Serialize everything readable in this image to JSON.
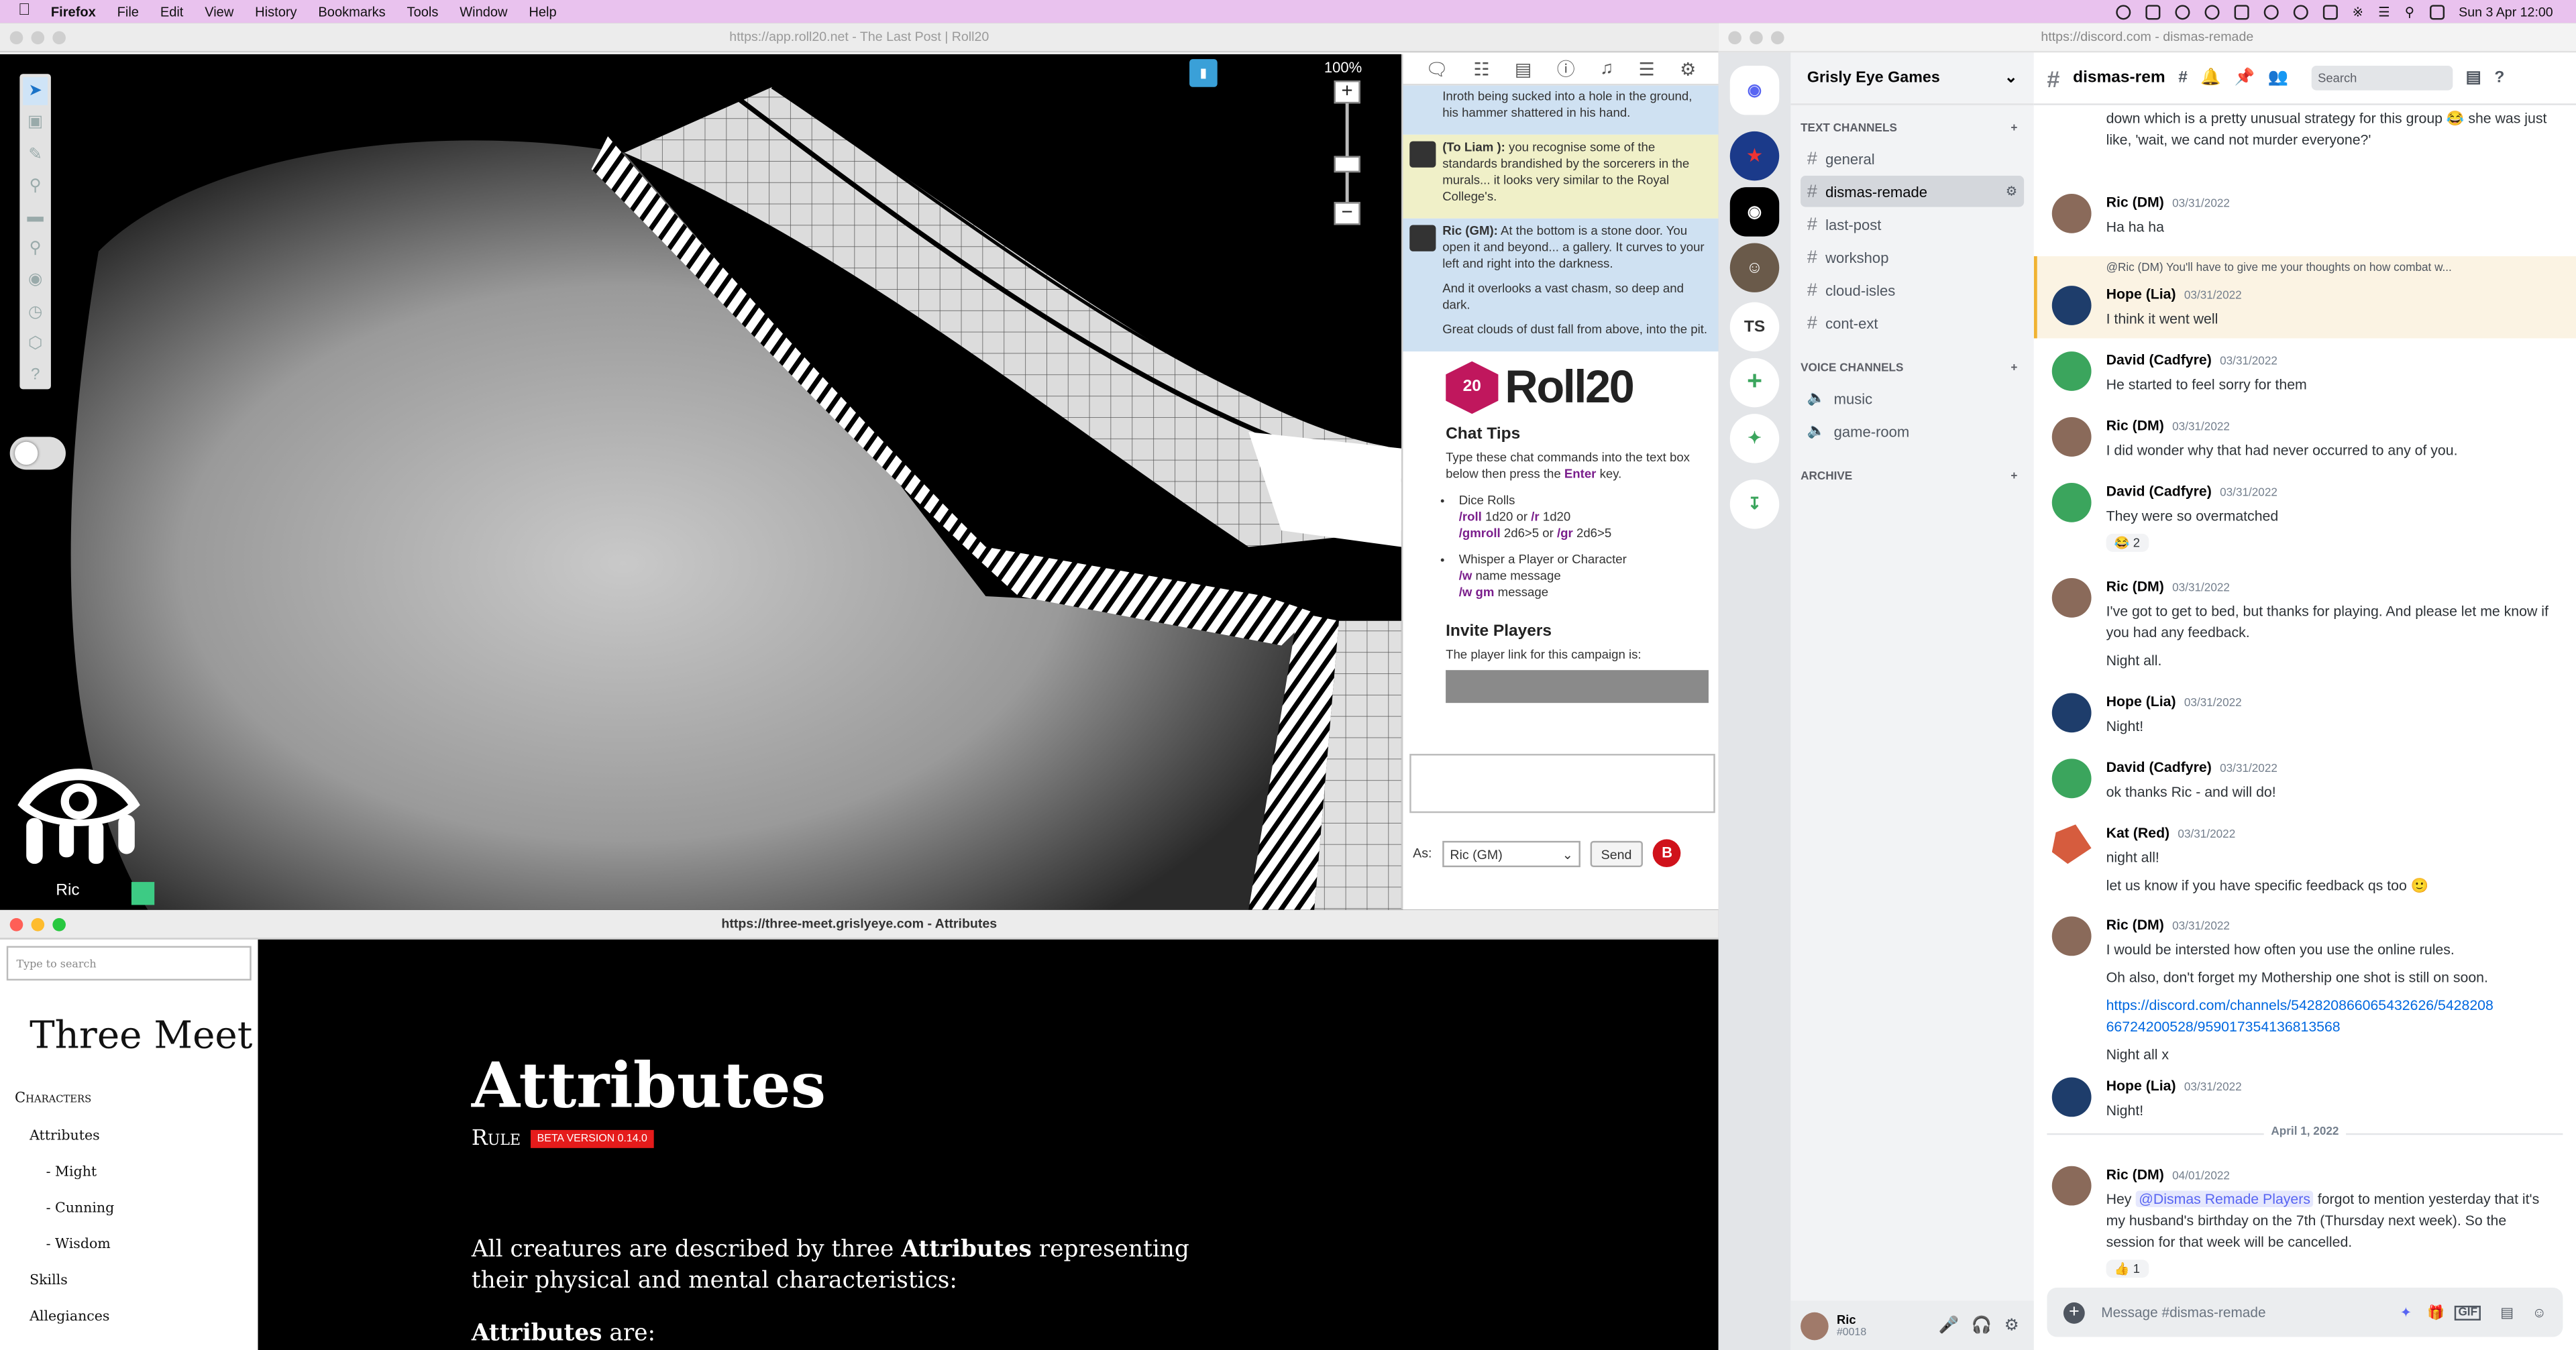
{
  "menubar": {
    "app": "Firefox",
    "items": [
      "File",
      "Edit",
      "View",
      "History",
      "Bookmarks",
      "Tools",
      "Window",
      "Help"
    ],
    "clock": "Sun 3 Apr  12:00"
  },
  "roll20": {
    "url": "https://app.roll20.net - The Last Post | Roll20",
    "zoom": "100%",
    "player_name": "Ric",
    "player_color": "#3dcb84",
    "chat": {
      "msg0": "Inroth being sucked into a hole in the ground, his hammer shattered in his hand.",
      "whisper_who": "(To Liam ):",
      "whisper_text": " you recognise some of the standards brandished by the sorcerers in the murals... it looks very similar to the Royal College's.",
      "gm_who": "Ric (GM):",
      "gm_text1": " At the bottom is a stone door. You open it and beyond... a gallery. It curves to your left and right into the darkness.",
      "gm_text2": "And it overlooks a vast chasm, so deep and dark.",
      "gm_text3": "Great clouds of dust fall from above, into the pit."
    },
    "logo": {
      "die": "20",
      "word": "Roll20"
    },
    "tips": {
      "title": "Chat Tips",
      "intro1": "Type these chat commands into the text box below then press the ",
      "intro_key": "Enter",
      "intro2": " key.",
      "dice_title": "Dice Rolls",
      "roll_cmd": "/roll",
      "roll_arg1": " 1d20 or ",
      "r_cmd": "/r",
      "roll_arg2": " 1d20",
      "gmroll_cmd": "/gmroll",
      "gmroll_arg": " 2d6>5 or ",
      "gr_cmd": "/gr",
      "gr_arg": " 2d6>5",
      "whisper_title": "Whisper a Player or Character",
      "w_cmd": "/w",
      "w_arg": " name message",
      "wgm_cmd": "/w gm",
      "wgm_arg": " message"
    },
    "invite": {
      "title": "Invite Players",
      "text": "The player link for this campaign is:"
    },
    "as_label": "As:",
    "as_value": "Ric (GM)",
    "send": "Send",
    "badge": "B"
  },
  "threemeet": {
    "url": "https://three-meet.grislyeye.com - Attributes",
    "search_placeholder": "Type to search",
    "brand": "Three Meet",
    "nav": {
      "characters": "Characters",
      "attributes": "Attributes",
      "might": "- Might",
      "cunning": "- Cunning",
      "wisdom": "- Wisdom",
      "skills": "Skills",
      "allegiances": "Allegiances"
    },
    "title": "Attributes",
    "rule": "Rule",
    "beta": "BETA VERSION 0.14.0",
    "para_pre": "All creatures are described by three ",
    "para_bold": "Attributes",
    "para_post": " representing their physical and mental characteristics:",
    "para2_bold": "Attributes",
    "para2_post": " are:"
  },
  "discord": {
    "url": "https://discord.com - dismas-remade",
    "server": "Grisly Eye Games",
    "text_channels_label": "TEXT CHANNELS",
    "text_channels": [
      "general",
      "dismas-remade",
      "last-post",
      "workshop",
      "cloud-isles",
      "cont-ext"
    ],
    "voice_channels_label": "VOICE CHANNELS",
    "voice_channels": [
      "music",
      "game-room"
    ],
    "archive_label": "ARCHIVE",
    "user": {
      "name": "Ric",
      "tag": "#0018"
    },
    "ts_label": "TS",
    "channel_title": "dismas-rem",
    "search_placeholder": "Search",
    "input_placeholder": "Message #dismas-remade",
    "gif": "GIF",
    "date_divider": "April 1, 2022",
    "m0": {
      "text": "down which is a pretty unusual strategy for this group 😂 she was just like, 'wait, we cand not murder everyone?'"
    },
    "m1": {
      "who": "Ric (DM)",
      "time": "03/31/2022",
      "text": "Ha ha ha"
    },
    "m2": {
      "reply": "@Ric (DM) You'll have to give me your thoughts on how combat w...",
      "who": "Hope (Lia)",
      "time": "03/31/2022",
      "text": "I think it went well"
    },
    "m3": {
      "who": "David (Cadfyre)",
      "time": "03/31/2022",
      "text": "He started to feel sorry for them"
    },
    "m4": {
      "who": "Ric (DM)",
      "time": "03/31/2022",
      "text": "I did wonder why that had never occurred to any of you."
    },
    "m5": {
      "who": "David (Cadfyre)",
      "time": "03/31/2022",
      "text": "They were so overmatched",
      "react": "😂 2"
    },
    "m6": {
      "who": "Ric (DM)",
      "time": "03/31/2022",
      "text": "I've got to get to bed, but thanks for playing. And please let me know if you had any feedback.",
      "text2": "Night all."
    },
    "m7": {
      "who": "Hope (Lia)",
      "time": "03/31/2022",
      "text": "Night!"
    },
    "m8": {
      "who": "David (Cadfyre)",
      "time": "03/31/2022",
      "text": "ok thanks Ric - and will do!"
    },
    "m9": {
      "who": "Kat (Red)",
      "time": "03/31/2022",
      "text": "night all!",
      "text2": "let us know if you have specific feedback qs too 🙂"
    },
    "m10": {
      "who": "Ric (DM)",
      "time": "03/31/2022",
      "text": "I would be intersted how often you use the online rules.",
      "text2": "Oh also, don't forget my Mothership one shot is still on soon.",
      "link": "https://discord.com/channels/542820866065432626/542820866724200528/959017354136813568",
      "text3": "Night all x"
    },
    "m11": {
      "who": "Hope (Lia)",
      "time": "03/31/2022",
      "text": "Night!"
    },
    "m12": {
      "who": "Ric (DM)",
      "time": "04/01/2022",
      "pre": "Hey ",
      "mention": "@Dismas Remade Players",
      "post": " forgot to mention yesterday that it's my husband's birthday on the 7th (Thursday next week). So the session for that week will be cancelled.",
      "react": "👍 1"
    }
  }
}
